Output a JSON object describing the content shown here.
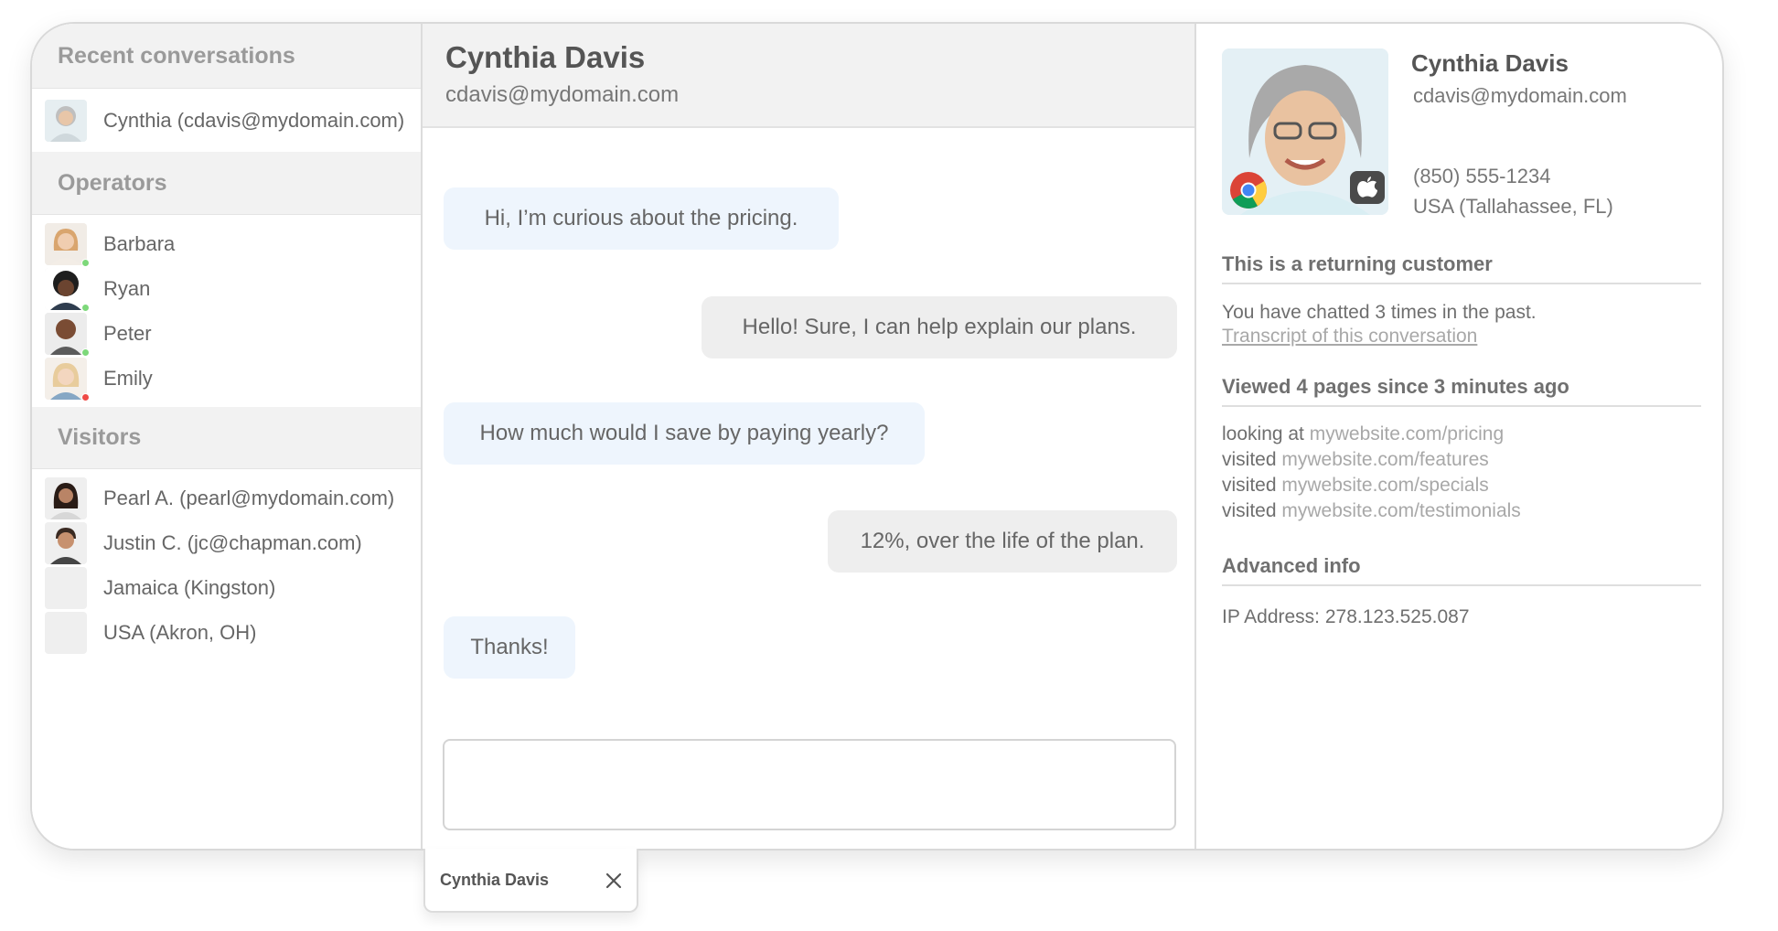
{
  "sidebar": {
    "recent_header": "Recent conversations",
    "recent": [
      {
        "label": "Cynthia (cdavis@mydomain.com)"
      }
    ],
    "operators_header": "Operators",
    "operators": [
      {
        "name": "Barbara",
        "status": "online",
        "status_color": "#7dd87a"
      },
      {
        "name": "Ryan",
        "status": "online",
        "status_color": "#7dd87a"
      },
      {
        "name": "Peter",
        "status": "online",
        "status_color": "#7dd87a"
      },
      {
        "name": "Emily",
        "status": "busy",
        "status_color": "#ef4a45"
      }
    ],
    "visitors_header": "Visitors",
    "visitors": [
      {
        "label": "Pearl A. (pearl@mydomain.com)"
      },
      {
        "label": "Justin C. (jc@chapman.com)"
      },
      {
        "label": "Jamaica (Kingston)"
      },
      {
        "label": "USA (Akron, OH)"
      }
    ]
  },
  "chat": {
    "name": "Cynthia Davis",
    "email": "cdavis@mydomain.com",
    "messages": [
      {
        "from": "visitor",
        "text": "Hi, I’m curious about the pricing."
      },
      {
        "from": "operator",
        "text": "Hello! Sure, I can help explain our plans."
      },
      {
        "from": "visitor",
        "text": "How much would I save by paying yearly?"
      },
      {
        "from": "operator",
        "text": "12%, over the life of the plan."
      },
      {
        "from": "visitor",
        "text": "Thanks!"
      }
    ],
    "composer_value": ""
  },
  "profile": {
    "name": "Cynthia Davis",
    "email": "cdavis@mydomain.com",
    "phone": "(850) 555-1234",
    "location": "USA (Tallahassee, FL)",
    "browser_icon": "chrome-icon",
    "os_icon": "apple-icon",
    "returning_title": "This is a returning customer",
    "chatted_text": "You have chatted 3 times in the past.",
    "transcript_link": "Transcript of this conversation",
    "viewed_title": "Viewed 4 pages since 3 minutes ago",
    "pages": [
      {
        "action": "looking at",
        "url": "mywebsite.com/pricing"
      },
      {
        "action": "visited",
        "url": "mywebsite.com/features"
      },
      {
        "action": "visited",
        "url": "mywebsite.com/specials"
      },
      {
        "action": "visited",
        "url": "mywebsite.com/testimonials"
      }
    ],
    "advanced_title": "Advanced info",
    "ip_text": "IP Address: 278.123.525.087"
  },
  "tab": {
    "name": "Cynthia Davis"
  },
  "colors": {
    "visitor_bubble": "#eef5fd",
    "operator_bubble": "#eeeeee",
    "header_bg": "#f2f2f2"
  }
}
